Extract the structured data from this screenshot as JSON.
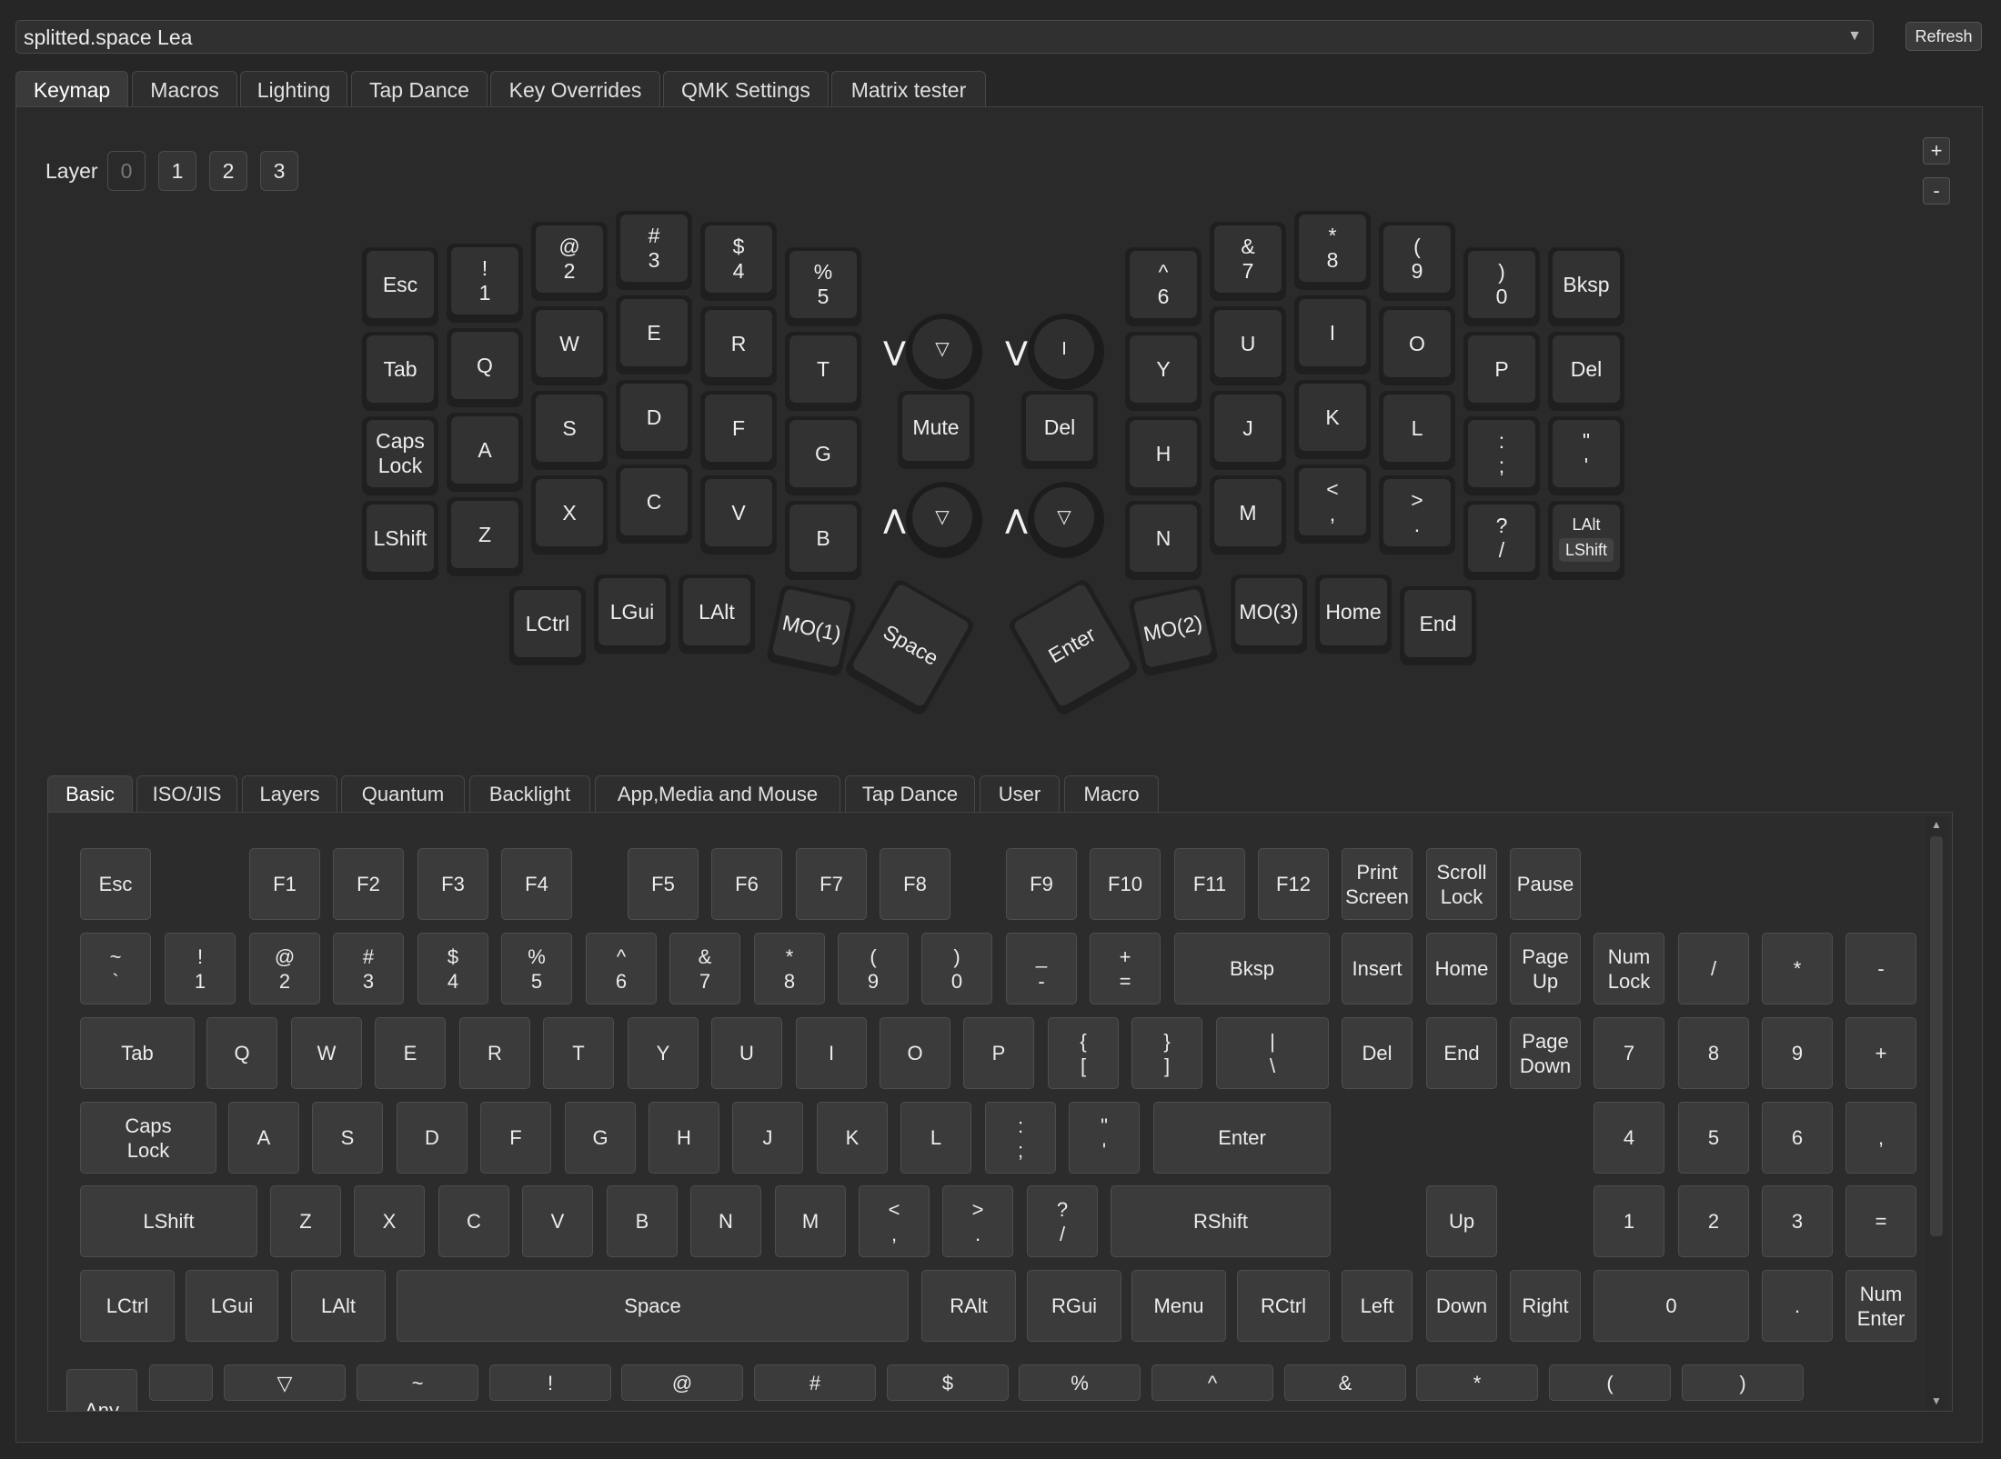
{
  "device": {
    "name": "splitted.space Lea",
    "refresh_label": "Refresh"
  },
  "tabs": [
    "Keymap",
    "Macros",
    "Lighting",
    "Tap Dance",
    "Key Overrides",
    "QMK Settings",
    "Matrix tester"
  ],
  "active_tab": "Keymap",
  "layer": {
    "label": "Layer",
    "buttons": [
      "0",
      "1",
      "2",
      "3"
    ],
    "active": "0"
  },
  "zoom": {
    "in": "+",
    "out": "-"
  },
  "split_keymap": {
    "left": [
      [
        "Esc"
      ],
      [
        "!",
        "1"
      ],
      [
        "@",
        "2"
      ],
      [
        "#",
        "3"
      ],
      [
        "$",
        "4"
      ],
      [
        "%",
        "5"
      ],
      [
        "Tab"
      ],
      [
        "Q"
      ],
      [
        "W"
      ],
      [
        "E"
      ],
      [
        "R"
      ],
      [
        "T"
      ],
      [
        "Caps",
        "Lock"
      ],
      [
        "A"
      ],
      [
        "S"
      ],
      [
        "D"
      ],
      [
        "F"
      ],
      [
        "G"
      ],
      [
        "LShift"
      ],
      [
        "Z"
      ],
      [
        "X"
      ],
      [
        "C"
      ],
      [
        "V"
      ],
      [
        "B"
      ],
      [
        "LCtrl"
      ],
      [
        "LGui"
      ],
      [
        "LAlt"
      ]
    ],
    "right": [
      [
        "^",
        "6"
      ],
      [
        "&",
        "7"
      ],
      [
        "*",
        "8"
      ],
      [
        "(",
        "9"
      ],
      [
        ")",
        "0"
      ],
      [
        "Bksp"
      ],
      [
        "Y"
      ],
      [
        "U"
      ],
      [
        "I"
      ],
      [
        "O"
      ],
      [
        "P"
      ],
      [
        "Del"
      ],
      [
        "H"
      ],
      [
        "J"
      ],
      [
        "K"
      ],
      [
        "L"
      ],
      [
        ":",
        ";"
      ],
      [
        "\"",
        "'"
      ],
      [
        "N"
      ],
      [
        "M"
      ],
      [
        "<",
        ","
      ],
      [
        ">",
        "."
      ],
      [
        "?",
        "/"
      ],
      [
        "MO(3)"
      ],
      [
        "Home"
      ],
      [
        "End"
      ]
    ],
    "mod_tap": {
      "top": "LAlt",
      "inner": "LShift"
    },
    "thumbs": {
      "mo1": "MO(1)",
      "space": "Space",
      "enter": "Enter",
      "mo2": "MO(2)"
    },
    "encoders": {
      "mute": "Mute",
      "del": "Del",
      "left_top_cap": "▽",
      "right_top_cap": "I",
      "left_bottom_cap": "▽",
      "right_bottom_cap": "▽",
      "arrow_down": "⋁",
      "arrow_up": "⋀"
    }
  },
  "keycode_tabs": [
    "Basic",
    "ISO/JIS",
    "Layers",
    "Quantum",
    "Backlight",
    "App,Media and Mouse",
    "Tap Dance",
    "User",
    "Macro"
  ],
  "active_keycode_tab": "Basic",
  "basic_keys": {
    "fn_row": [
      [
        "Esc"
      ],
      [
        "F1"
      ],
      [
        "F2"
      ],
      [
        "F3"
      ],
      [
        "F4"
      ],
      [
        "F5"
      ],
      [
        "F6"
      ],
      [
        "F7"
      ],
      [
        "F8"
      ],
      [
        "F9"
      ],
      [
        "F10"
      ],
      [
        "F11"
      ],
      [
        "F12"
      ],
      [
        "Print",
        "Screen"
      ],
      [
        "Scroll",
        "Lock"
      ],
      [
        "Pause"
      ]
    ],
    "num_row": [
      [
        "~",
        "`"
      ],
      [
        "!",
        "1"
      ],
      [
        "@",
        "2"
      ],
      [
        "#",
        "3"
      ],
      [
        "$",
        "4"
      ],
      [
        "%",
        "5"
      ],
      [
        "^",
        "6"
      ],
      [
        "&",
        "7"
      ],
      [
        "*",
        "8"
      ],
      [
        "(",
        "9"
      ],
      [
        ")",
        "0"
      ],
      [
        "_",
        "-"
      ],
      [
        "+",
        "="
      ],
      [
        "Bksp"
      ],
      [
        "Insert"
      ],
      [
        "Home"
      ],
      [
        "Page",
        "Up"
      ],
      [
        "Num",
        "Lock"
      ],
      [
        "/"
      ],
      [
        "*"
      ],
      [
        "-"
      ]
    ],
    "tab_row": [
      [
        "Tab"
      ],
      [
        "Q"
      ],
      [
        "W"
      ],
      [
        "E"
      ],
      [
        "R"
      ],
      [
        "T"
      ],
      [
        "Y"
      ],
      [
        "U"
      ],
      [
        "I"
      ],
      [
        "O"
      ],
      [
        "P"
      ],
      [
        "{",
        "["
      ],
      [
        "}",
        "]"
      ],
      [
        "|",
        "\\"
      ],
      [
        "Del"
      ],
      [
        "End"
      ],
      [
        "Page",
        "Down"
      ],
      [
        "7"
      ],
      [
        "8"
      ],
      [
        "9"
      ],
      [
        "+"
      ]
    ],
    "caps_row": [
      [
        "Caps",
        "Lock"
      ],
      [
        "A"
      ],
      [
        "S"
      ],
      [
        "D"
      ],
      [
        "F"
      ],
      [
        "G"
      ],
      [
        "H"
      ],
      [
        "J"
      ],
      [
        "K"
      ],
      [
        "L"
      ],
      [
        ":",
        ";"
      ],
      [
        "\"",
        "'"
      ],
      [
        "Enter"
      ],
      [
        "4"
      ],
      [
        "5"
      ],
      [
        "6"
      ],
      [
        ","
      ]
    ],
    "shift_row": [
      [
        "LShift"
      ],
      [
        "Z"
      ],
      [
        "X"
      ],
      [
        "C"
      ],
      [
        "V"
      ],
      [
        "B"
      ],
      [
        "N"
      ],
      [
        "M"
      ],
      [
        "<",
        ","
      ],
      [
        ">",
        "."
      ],
      [
        "?",
        "/"
      ],
      [
        "RShift"
      ],
      [
        "Up"
      ],
      [
        "1"
      ],
      [
        "2"
      ],
      [
        "3"
      ],
      [
        "="
      ]
    ],
    "ctrl_row": [
      [
        "LCtrl"
      ],
      [
        "LGui"
      ],
      [
        "LAlt"
      ],
      [
        "Space"
      ],
      [
        "RAlt"
      ],
      [
        "RGui"
      ],
      [
        "Menu"
      ],
      [
        "RCtrl"
      ],
      [
        "Left"
      ],
      [
        "Down"
      ],
      [
        "Right"
      ],
      [
        "0"
      ],
      [
        "."
      ],
      [
        "Num",
        "Enter"
      ]
    ],
    "extra_row": [
      [
        "Any"
      ],
      [
        ""
      ],
      [
        "▽"
      ],
      [
        "~"
      ],
      [
        "!"
      ],
      [
        "@"
      ],
      [
        "#"
      ],
      [
        "$"
      ],
      [
        "%"
      ],
      [
        "^"
      ],
      [
        "&"
      ],
      [
        "*"
      ],
      [
        "("
      ],
      [
        ")"
      ]
    ]
  }
}
